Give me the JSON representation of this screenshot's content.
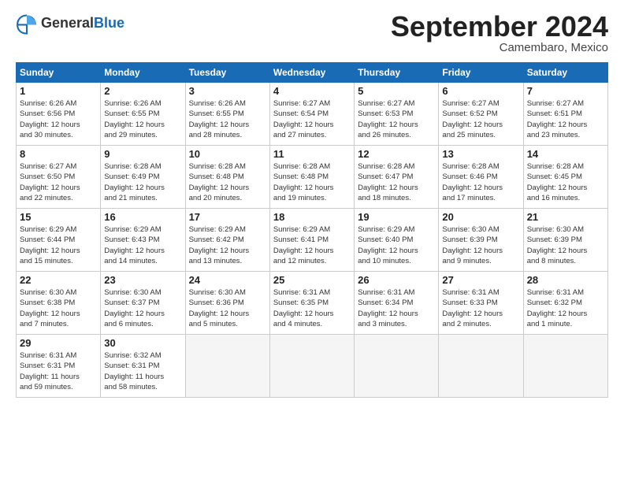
{
  "logo": {
    "general": "General",
    "blue": "Blue"
  },
  "title": "September 2024",
  "location": "Camembaro, Mexico",
  "days_header": [
    "Sunday",
    "Monday",
    "Tuesday",
    "Wednesday",
    "Thursday",
    "Friday",
    "Saturday"
  ],
  "weeks": [
    [
      {
        "day": "1",
        "info": "Sunrise: 6:26 AM\nSunset: 6:56 PM\nDaylight: 12 hours\nand 30 minutes."
      },
      {
        "day": "2",
        "info": "Sunrise: 6:26 AM\nSunset: 6:55 PM\nDaylight: 12 hours\nand 29 minutes."
      },
      {
        "day": "3",
        "info": "Sunrise: 6:26 AM\nSunset: 6:55 PM\nDaylight: 12 hours\nand 28 minutes."
      },
      {
        "day": "4",
        "info": "Sunrise: 6:27 AM\nSunset: 6:54 PM\nDaylight: 12 hours\nand 27 minutes."
      },
      {
        "day": "5",
        "info": "Sunrise: 6:27 AM\nSunset: 6:53 PM\nDaylight: 12 hours\nand 26 minutes."
      },
      {
        "day": "6",
        "info": "Sunrise: 6:27 AM\nSunset: 6:52 PM\nDaylight: 12 hours\nand 25 minutes."
      },
      {
        "day": "7",
        "info": "Sunrise: 6:27 AM\nSunset: 6:51 PM\nDaylight: 12 hours\nand 23 minutes."
      }
    ],
    [
      {
        "day": "8",
        "info": "Sunrise: 6:27 AM\nSunset: 6:50 PM\nDaylight: 12 hours\nand 22 minutes."
      },
      {
        "day": "9",
        "info": "Sunrise: 6:28 AM\nSunset: 6:49 PM\nDaylight: 12 hours\nand 21 minutes."
      },
      {
        "day": "10",
        "info": "Sunrise: 6:28 AM\nSunset: 6:48 PM\nDaylight: 12 hours\nand 20 minutes."
      },
      {
        "day": "11",
        "info": "Sunrise: 6:28 AM\nSunset: 6:48 PM\nDaylight: 12 hours\nand 19 minutes."
      },
      {
        "day": "12",
        "info": "Sunrise: 6:28 AM\nSunset: 6:47 PM\nDaylight: 12 hours\nand 18 minutes."
      },
      {
        "day": "13",
        "info": "Sunrise: 6:28 AM\nSunset: 6:46 PM\nDaylight: 12 hours\nand 17 minutes."
      },
      {
        "day": "14",
        "info": "Sunrise: 6:28 AM\nSunset: 6:45 PM\nDaylight: 12 hours\nand 16 minutes."
      }
    ],
    [
      {
        "day": "15",
        "info": "Sunrise: 6:29 AM\nSunset: 6:44 PM\nDaylight: 12 hours\nand 15 minutes."
      },
      {
        "day": "16",
        "info": "Sunrise: 6:29 AM\nSunset: 6:43 PM\nDaylight: 12 hours\nand 14 minutes."
      },
      {
        "day": "17",
        "info": "Sunrise: 6:29 AM\nSunset: 6:42 PM\nDaylight: 12 hours\nand 13 minutes."
      },
      {
        "day": "18",
        "info": "Sunrise: 6:29 AM\nSunset: 6:41 PM\nDaylight: 12 hours\nand 12 minutes."
      },
      {
        "day": "19",
        "info": "Sunrise: 6:29 AM\nSunset: 6:40 PM\nDaylight: 12 hours\nand 10 minutes."
      },
      {
        "day": "20",
        "info": "Sunrise: 6:30 AM\nSunset: 6:39 PM\nDaylight: 12 hours\nand 9 minutes."
      },
      {
        "day": "21",
        "info": "Sunrise: 6:30 AM\nSunset: 6:39 PM\nDaylight: 12 hours\nand 8 minutes."
      }
    ],
    [
      {
        "day": "22",
        "info": "Sunrise: 6:30 AM\nSunset: 6:38 PM\nDaylight: 12 hours\nand 7 minutes."
      },
      {
        "day": "23",
        "info": "Sunrise: 6:30 AM\nSunset: 6:37 PM\nDaylight: 12 hours\nand 6 minutes."
      },
      {
        "day": "24",
        "info": "Sunrise: 6:30 AM\nSunset: 6:36 PM\nDaylight: 12 hours\nand 5 minutes."
      },
      {
        "day": "25",
        "info": "Sunrise: 6:31 AM\nSunset: 6:35 PM\nDaylight: 12 hours\nand 4 minutes."
      },
      {
        "day": "26",
        "info": "Sunrise: 6:31 AM\nSunset: 6:34 PM\nDaylight: 12 hours\nand 3 minutes."
      },
      {
        "day": "27",
        "info": "Sunrise: 6:31 AM\nSunset: 6:33 PM\nDaylight: 12 hours\nand 2 minutes."
      },
      {
        "day": "28",
        "info": "Sunrise: 6:31 AM\nSunset: 6:32 PM\nDaylight: 12 hours\nand 1 minute."
      }
    ],
    [
      {
        "day": "29",
        "info": "Sunrise: 6:31 AM\nSunset: 6:31 PM\nDaylight: 11 hours\nand 59 minutes."
      },
      {
        "day": "30",
        "info": "Sunrise: 6:32 AM\nSunset: 6:31 PM\nDaylight: 11 hours\nand 58 minutes."
      },
      {
        "day": "",
        "info": ""
      },
      {
        "day": "",
        "info": ""
      },
      {
        "day": "",
        "info": ""
      },
      {
        "day": "",
        "info": ""
      },
      {
        "day": "",
        "info": ""
      }
    ]
  ]
}
